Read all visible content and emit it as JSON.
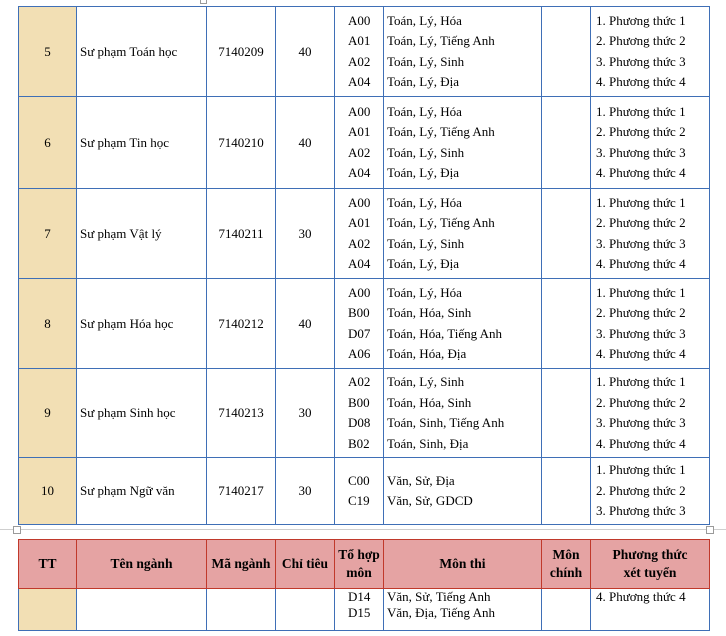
{
  "rows": [
    {
      "tt": "5",
      "name": "Sư phạm Toán học",
      "code": "7140209",
      "quota": "40",
      "combos": [
        "A00",
        "A01",
        "A02",
        "A04"
      ],
      "subjects": [
        "Toán, Lý, Hóa",
        "Toán, Lý, Tiếng Anh",
        "Toán, Lý, Sinh",
        "Toán, Lý, Địa"
      ],
      "methods": [
        "1. Phương thức 1",
        "2. Phương thức 2",
        "3. Phương thức 3",
        "4. Phương thức 4"
      ]
    },
    {
      "tt": "6",
      "name": "Sư phạm Tin học",
      "code": "7140210",
      "quota": "40",
      "combos": [
        "A00",
        "A01",
        "A02",
        "A04"
      ],
      "subjects": [
        "Toán, Lý, Hóa",
        "Toán, Lý, Tiếng Anh",
        "Toán, Lý, Sinh",
        "Toán, Lý, Địa"
      ],
      "methods": [
        "1. Phương thức 1",
        "2. Phương thức 2",
        "3. Phương thức 3",
        "4. Phương thức 4"
      ]
    },
    {
      "tt": "7",
      "name": "Sư phạm Vật lý",
      "code": "7140211",
      "quota": "30",
      "combos": [
        "A00",
        "A01",
        "A02",
        "A04"
      ],
      "subjects": [
        "Toán, Lý, Hóa",
        "Toán, Lý, Tiếng Anh",
        "Toán, Lý, Sinh",
        "Toán, Lý, Địa"
      ],
      "methods": [
        "1. Phương thức 1",
        "2. Phương thức 2",
        "3. Phương thức 3",
        "4. Phương thức 4"
      ]
    },
    {
      "tt": "8",
      "name": "Sư phạm Hóa học",
      "code": "7140212",
      "quota": "40",
      "combos": [
        "A00",
        "B00",
        "D07",
        "A06"
      ],
      "subjects": [
        "Toán, Lý, Hóa",
        "Toán, Hóa, Sinh",
        "Toán, Hóa, Tiếng Anh",
        "Toán, Hóa, Địa"
      ],
      "methods": [
        "1. Phương thức 1",
        "2. Phương thức 2",
        "3. Phương thức 3",
        "4. Phương thức 4"
      ]
    },
    {
      "tt": "9",
      "name": "Sư phạm Sinh học",
      "code": "7140213",
      "quota": "30",
      "combos": [
        "A02",
        "B00",
        "D08",
        "B02"
      ],
      "subjects": [
        "Toán, Lý, Sinh",
        "Toán, Hóa, Sinh",
        "Toán, Sinh, Tiếng Anh",
        "Toán, Sinh, Địa"
      ],
      "methods": [
        "1. Phương thức 1",
        "2. Phương thức 2",
        "3. Phương thức 3",
        "4. Phương thức 4"
      ]
    },
    {
      "tt": "10",
      "name": "Sư phạm Ngữ văn",
      "code": "7140217",
      "quota": "30",
      "combos": [
        "C00",
        "C19"
      ],
      "subjects": [
        "Văn, Sử, Địa",
        "Văn, Sử, GDCD"
      ],
      "methods": [
        "1. Phương thức 1",
        "2. Phương thức 2",
        "3. Phương thức 3"
      ]
    }
  ],
  "header": {
    "tt": "TT",
    "name": "Tên ngành",
    "code": "Mã ngành",
    "quota": "Chỉ tiêu",
    "combo_1": "Tổ hợp",
    "combo_2": "môn",
    "subjects": "Môn thi",
    "main_1": "Môn",
    "main_2": "chính",
    "method_1": "Phương thức",
    "method_2": "xét tuyển"
  },
  "cont_row": {
    "combos": [
      "D14",
      "D15"
    ],
    "subjects": [
      "Văn, Sử, Tiếng Anh",
      "Văn, Địa, Tiếng Anh"
    ],
    "method": "4. Phương thức 4"
  },
  "colors": {
    "tt_fill": "#f2dfb4",
    "header_fill": "#e5a3a3",
    "border": "#3f6fb6",
    "header_border": "#c0392b"
  }
}
